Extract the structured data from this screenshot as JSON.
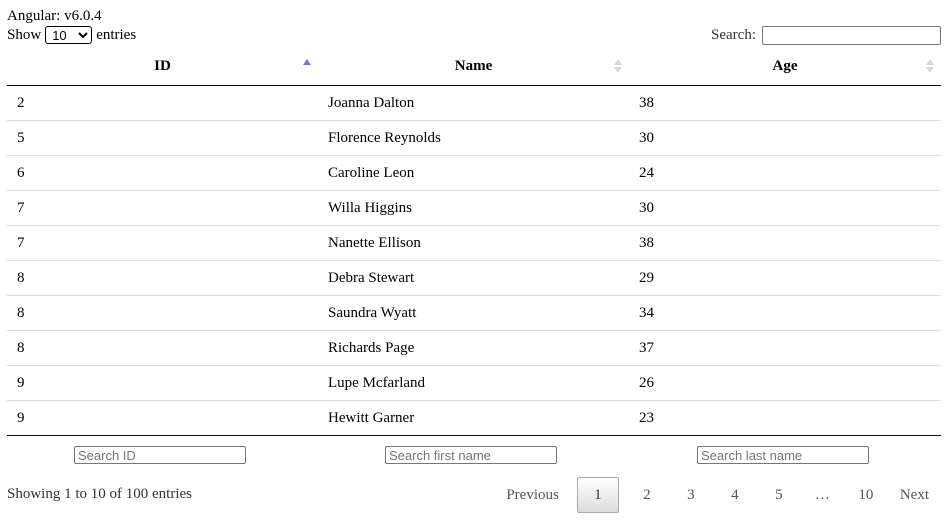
{
  "header": {
    "version_label": "Angular: v6.0.4"
  },
  "length_control": {
    "show_label": "Show",
    "selected": "10",
    "entries_label": "entries"
  },
  "search": {
    "label": "Search:",
    "value": ""
  },
  "table": {
    "columns": [
      {
        "label": "ID",
        "sort": "ascending"
      },
      {
        "label": "Name",
        "sort": "none"
      },
      {
        "label": "Age",
        "sort": "none"
      }
    ],
    "rows": [
      {
        "id": "2",
        "name": "Joanna Dalton",
        "age": "38"
      },
      {
        "id": "5",
        "name": "Florence Reynolds",
        "age": "30"
      },
      {
        "id": "6",
        "name": "Caroline Leon",
        "age": "24"
      },
      {
        "id": "7",
        "name": "Willa Higgins",
        "age": "30"
      },
      {
        "id": "7",
        "name": "Nanette Ellison",
        "age": "38"
      },
      {
        "id": "8",
        "name": "Debra Stewart",
        "age": "29"
      },
      {
        "id": "8",
        "name": "Saundra Wyatt",
        "age": "34"
      },
      {
        "id": "8",
        "name": "Richards Page",
        "age": "37"
      },
      {
        "id": "9",
        "name": "Lupe Mcfarland",
        "age": "26"
      },
      {
        "id": "9",
        "name": "Hewitt Garner",
        "age": "23"
      }
    ]
  },
  "column_filters": {
    "id_placeholder": "Search ID",
    "first_name_placeholder": "Search first name",
    "last_name_placeholder": "Search last name"
  },
  "info": "Showing 1 to 10 of 100 entries",
  "pagination": {
    "previous": "Previous",
    "pages": [
      "1",
      "2",
      "3",
      "4",
      "5"
    ],
    "current": "1",
    "ellipsis": "…",
    "last": "10",
    "next": "Next"
  },
  "colors": {
    "sort_active": "#7b72c8",
    "sort_inactive": "#d6d6d6"
  }
}
